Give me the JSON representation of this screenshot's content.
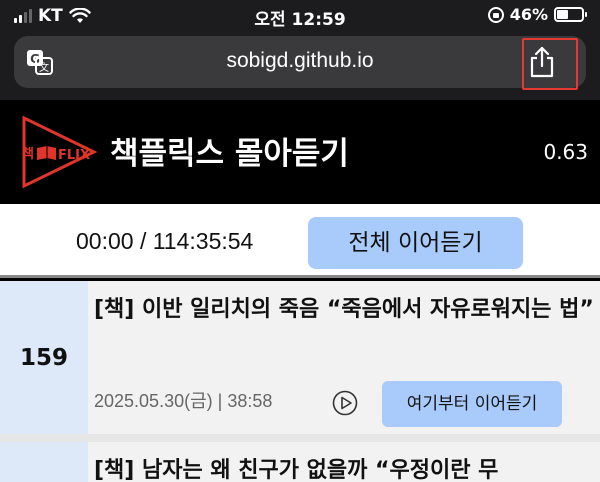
{
  "status_bar": {
    "carrier": "KT",
    "time": "오전 12:59",
    "battery_percent": "46%",
    "battery_level": 0.46
  },
  "browser": {
    "url": "sobigd.github.io",
    "translate_icon": "translate-icon",
    "share_icon": "share-icon"
  },
  "app": {
    "title": "책플릭스 몰아듣기",
    "version": "0.63",
    "logo_text": "책FLIX"
  },
  "controls": {
    "timer": "00:00 / 114:35:54",
    "resume_all_label": "전체 이어듣기"
  },
  "items": [
    {
      "number": "159",
      "title": "[책] 이반 일리치의 죽음 “죽음에서 자유로워지는 법”",
      "meta": "2025.05.30(금) | 38:58",
      "resume_label": "여기부터 이어듣기"
    },
    {
      "number": "",
      "title": "[책] 남자는 왜 친구가 없을까 “우정이란 무",
      "meta": "",
      "resume_label": ""
    }
  ],
  "colors": {
    "accent_button": "#a9cbfb",
    "logo_red": "#e0352b",
    "highlight_box": "#e53935"
  }
}
